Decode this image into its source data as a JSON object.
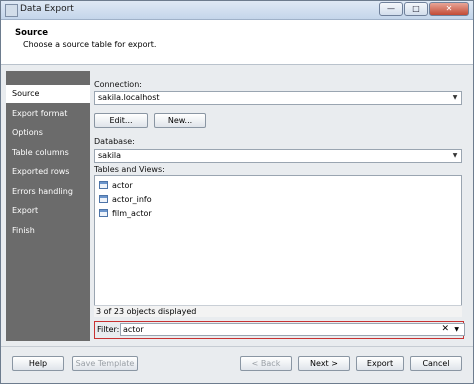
{
  "window": {
    "title": "Data Export"
  },
  "header": {
    "title": "Source",
    "subtitle": "Choose a source table for export."
  },
  "sidebar": {
    "items": [
      {
        "label": "Source"
      },
      {
        "label": "Export format"
      },
      {
        "label": "Options"
      },
      {
        "label": "Table columns"
      },
      {
        "label": "Exported rows"
      },
      {
        "label": "Errors handling"
      },
      {
        "label": "Export"
      },
      {
        "label": "Finish"
      }
    ],
    "active": "Source"
  },
  "connection": {
    "label": "Connection:",
    "value": "sakila.localhost",
    "edit_label": "Edit...",
    "new_label": "New..."
  },
  "database": {
    "label": "Database:",
    "value": "sakila"
  },
  "tables": {
    "label": "Tables and Views:",
    "items": [
      {
        "name": "actor"
      },
      {
        "name": "actor_info"
      },
      {
        "name": "film_actor"
      }
    ],
    "status": "3 of 23 objects displayed"
  },
  "filter": {
    "label": "Filter:",
    "value": "actor"
  },
  "footer": {
    "help": "Help",
    "save_template": "Save Template",
    "back": "< Back",
    "next": "Next >",
    "export": "Export",
    "cancel": "Cancel"
  }
}
